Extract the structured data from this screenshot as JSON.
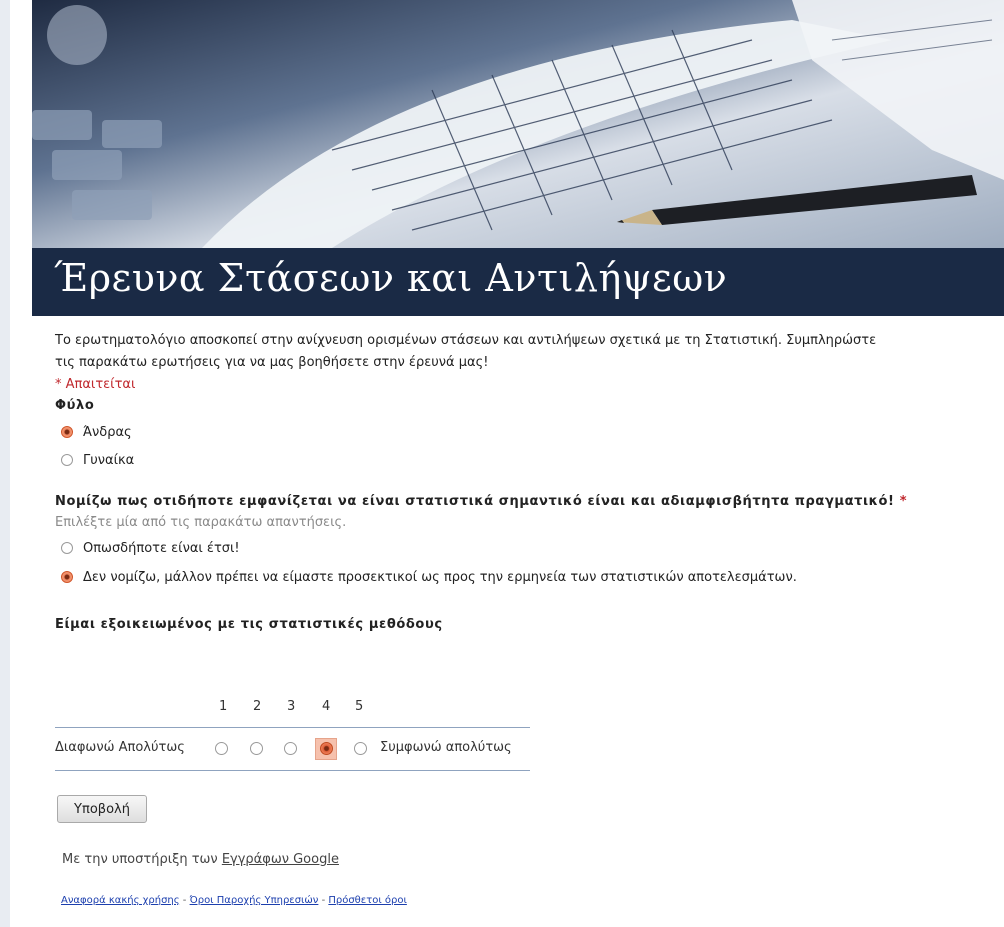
{
  "header": {
    "title": "Έρευνα Στάσεων και Αντιλήψεων"
  },
  "form": {
    "description_line1": "Το ερωτηματολόγιο αποσκοπεί στην ανίχνευση ορισμένων στάσεων και αντιλήψεων σχετικά με τη Στατιστική. Συμπληρώστε",
    "description_line2": "τις παρακάτω ερωτήσεις για να μας βοηθήσετε στην έρευνά μας!",
    "required_note": "* Απαιτείται"
  },
  "q1": {
    "title": "Φύλο",
    "options": [
      {
        "label": "Άνδρας",
        "checked": true
      },
      {
        "label": "Γυναίκα",
        "checked": false
      }
    ]
  },
  "q2": {
    "title": "Νομίζω πως οτιδήποτε εμφανίζεται να είναι στατιστικά σημαντικό είναι και αδιαμφισβήτητα πραγματικό!",
    "required_mark": "*",
    "help": "Επιλέξτε μία από τις παρακάτω απαντήσεις.",
    "options": [
      {
        "label": "Οπωσδήποτε είναι έτσι!",
        "checked": false
      },
      {
        "label": "Δεν νομίζω, μάλλον πρέπει να είμαστε προσεκτικοί ως προς την ερμηνεία των στατιστικών αποτελεσμάτων.",
        "checked": true
      }
    ]
  },
  "q3": {
    "title": "Είμαι εξοικειωμένος με τις στατιστικές μεθόδους",
    "scale_numbers": [
      "1",
      "2",
      "3",
      "4",
      "5"
    ],
    "low_label": "Διαφωνώ Απολύτως",
    "high_label": "Συμφωνώ απολύτως",
    "selected": 4
  },
  "actions": {
    "submit_label": "Υποβολή"
  },
  "footer": {
    "powered_prefix": "Με την υποστήριξη των ",
    "powered_link": "Εγγράφων Google",
    "link_abuse": "Αναφορά κακής χρήσης",
    "link_terms": "Όροι Παροχής Υπηρεσιών",
    "link_additional": "Πρόσθετοι όροι",
    "separator": " - "
  },
  "colors": {
    "title_bar": "#1a2a45",
    "required": "#c0282d",
    "radio_checked": "#e0603a",
    "link": "#1c3fae"
  }
}
